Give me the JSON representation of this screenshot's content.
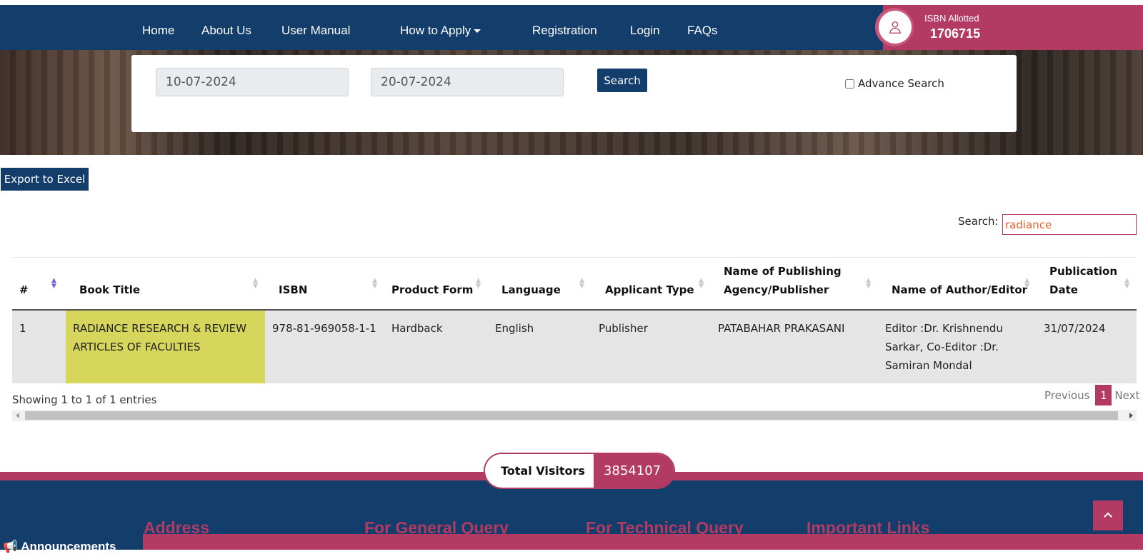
{
  "nav": {
    "items": [
      "Home",
      "About Us",
      "User Manual",
      "How to Apply",
      "Registration",
      "Login",
      "FAQs"
    ]
  },
  "isbn": {
    "label": "ISBN Allotted",
    "count": "1706715"
  },
  "search": {
    "from_date": "10-07-2024",
    "to_date": "20-07-2024",
    "button": "Search",
    "advance_label": "Advance Search"
  },
  "export_label": "Export to Excel",
  "table_search": {
    "label": "Search:",
    "value": "radiance"
  },
  "table": {
    "headers": [
      "#",
      "Book Title",
      "ISBN",
      "Product Form",
      "Language",
      "Applicant Type",
      "Name of Publishing Agency/Publisher",
      "Name of Author/Editor",
      "Publication Date"
    ],
    "rows": [
      [
        "1",
        "RADIANCE RESEARCH & REVIEW ARTICLES OF FACULTIES",
        "978-81-969058-1-1",
        "Hardback",
        "English",
        "Publisher",
        "PATABAHAR PRAKASANI",
        "Editor :Dr. Krishnendu Sarkar, Co-Editor :Dr. Samiran Mondal",
        "31/07/2024"
      ]
    ]
  },
  "showing": "Showing 1 to 1 of 1 entries",
  "pager": {
    "previous": "Previous",
    "current": "1",
    "next": "Next"
  },
  "visitors": {
    "label": "Total Visitors",
    "count": "3854107"
  },
  "footer": {
    "headings": [
      "Address",
      "For General Query",
      "For Technical Query",
      "Important Links"
    ],
    "announcements": "Announcements"
  },
  "colors": {
    "navy": "#133d6b",
    "crimson": "#b23a63",
    "highlight": "#d6d55c"
  },
  "icons": {
    "isbn": "user-icon",
    "top": "chevron-up-icon",
    "announce": "megaphone-icon"
  }
}
